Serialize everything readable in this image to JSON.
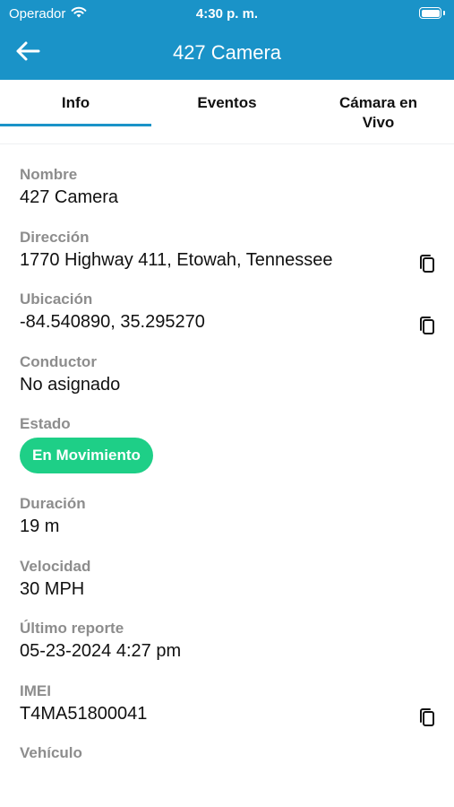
{
  "status_bar": {
    "carrier": "Operador",
    "time": "4:30 p. m.",
    "battery_level": 1.0
  },
  "nav": {
    "title": "427 Camera",
    "back_icon": "arrow-left-icon"
  },
  "tabs": [
    {
      "label": "Info",
      "selected": true
    },
    {
      "label": "Eventos",
      "selected": false
    },
    {
      "label": "Cámara en Vivo",
      "selected": false
    }
  ],
  "fields": {
    "nombre": {
      "label": "Nombre",
      "value": "427 Camera"
    },
    "direccion": {
      "label": "Dirección",
      "value": "1770 Highway 411, Etowah, Tennessee"
    },
    "ubicacion": {
      "label": "Ubicación",
      "value": "-84.540890, 35.295270"
    },
    "conductor": {
      "label": "Conductor",
      "value": "No asignado"
    },
    "estado": {
      "label": "Estado",
      "value": "En Movimiento"
    },
    "duracion": {
      "label": "Duración",
      "value": "19 m"
    },
    "velocidad": {
      "label": "Velocidad",
      "value": "30 MPH"
    },
    "ultimo_reporte": {
      "label": "Último reporte",
      "value": "05-23-2024 4:27 pm"
    },
    "imei": {
      "label": "IMEI",
      "value": "T4MA51800041"
    },
    "vehiculo": {
      "label": "Vehículo"
    }
  },
  "colors": {
    "accent": "#1a93c8",
    "status_green": "#1ecf87",
    "label_gray": "#8d8d8d"
  },
  "icons": {
    "copy": "copy-icon",
    "wifi": "wifi-icon",
    "battery": "battery-icon"
  }
}
